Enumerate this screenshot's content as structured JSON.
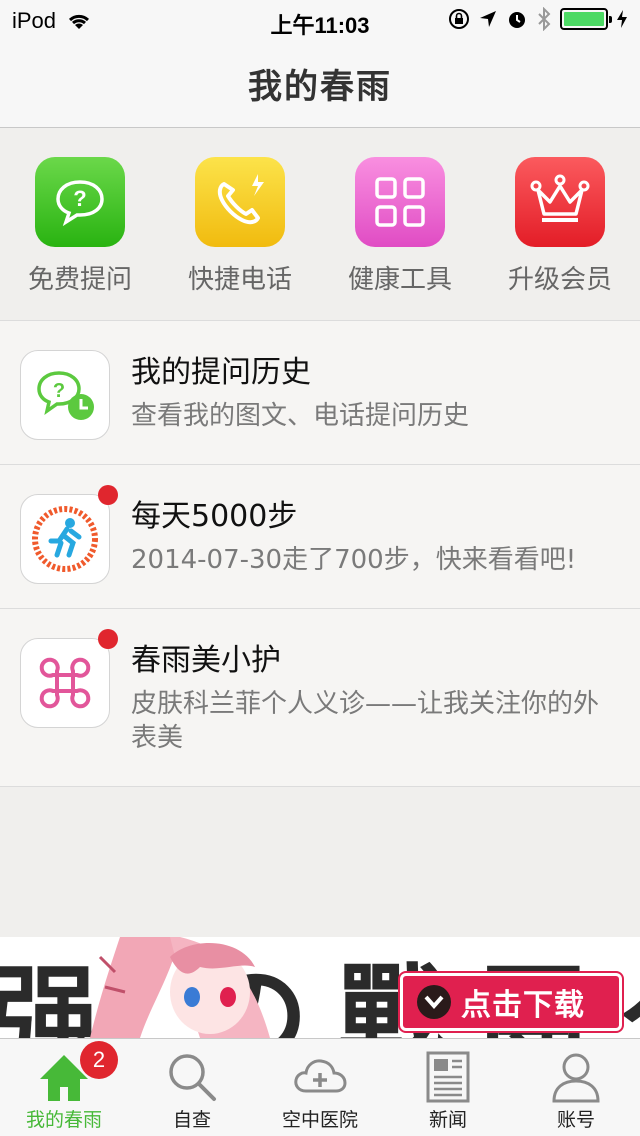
{
  "status_bar": {
    "carrier": "iPod",
    "time": "上午11:03",
    "battery_level": 1.0,
    "icons": [
      "wifi-icon",
      "orientation-lock-icon",
      "location-icon",
      "alarm-icon",
      "bluetooth-icon",
      "battery-icon",
      "charging-icon"
    ]
  },
  "nav": {
    "title": "我的春雨"
  },
  "quick_actions": [
    {
      "label": "免费提问",
      "icon": "chat-question-icon",
      "color": "#3fc42a"
    },
    {
      "label": "快捷电话",
      "icon": "phone-icon",
      "color": "#f5c51f"
    },
    {
      "label": "健康工具",
      "icon": "grid-icon",
      "color": "#ee6ad3"
    },
    {
      "label": "升级会员",
      "icon": "crown-icon",
      "color": "#f03a3f"
    }
  ],
  "list": [
    {
      "title": "我的提问历史",
      "subtitle": "查看我的图文、电话提问历史",
      "icon": "question-history-icon",
      "has_dot": false
    },
    {
      "title": "每天5000步",
      "subtitle": "2014-07-30走了700步，快来看看吧!",
      "icon": "pedometer-icon",
      "has_dot": true
    },
    {
      "title": "春雨美小护",
      "subtitle": "皮肤科兰菲个人义诊——让我关注你的外表美",
      "icon": "beauty-clover-icon",
      "has_dot": true
    }
  ],
  "ad": {
    "button_label": "点击下载",
    "bg_text": "强 の戰團グ"
  },
  "tabs": [
    {
      "label": "我的春雨",
      "icon": "home-icon",
      "active": true,
      "badge": "2"
    },
    {
      "label": "自查",
      "icon": "search-icon",
      "active": false
    },
    {
      "label": "空中医院",
      "icon": "cloud-plus-icon",
      "active": false
    },
    {
      "label": "新闻",
      "icon": "news-icon",
      "active": false
    },
    {
      "label": "账号",
      "icon": "person-icon",
      "active": false
    }
  ],
  "colors": {
    "accent_green": "#47b938",
    "badge_red": "#e0262e",
    "ad_red": "#e0204f"
  }
}
